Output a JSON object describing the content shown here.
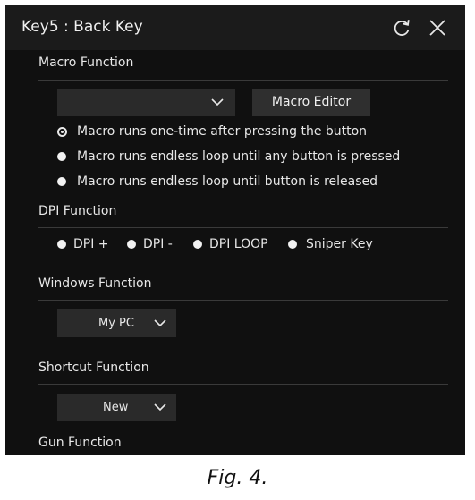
{
  "window": {
    "title": "Key5 : Back Key",
    "refresh_icon": "refresh-icon",
    "close_icon": "close-icon"
  },
  "macro": {
    "label": "Macro Function",
    "dropdown_value": "",
    "editor_button": "Macro Editor",
    "options": [
      {
        "label": "Macro runs one-time after pressing the button",
        "selected": true
      },
      {
        "label": "Macro runs endless loop until any button is pressed",
        "selected": false
      },
      {
        "label": "Macro runs endless loop until button is released",
        "selected": false
      }
    ]
  },
  "dpi": {
    "label": "DPI Function",
    "options": [
      "DPI +",
      "DPI -",
      "DPI LOOP",
      "Sniper Key"
    ]
  },
  "windows": {
    "label": "Windows Function",
    "dropdown_value": "My PC"
  },
  "shortcut": {
    "label": "Shortcut Function",
    "dropdown_value": "New"
  },
  "gun": {
    "label": "Gun Function"
  },
  "caption": "Fig. 4.",
  "colors": {
    "background": "#101010",
    "titlebar": "#1b1b1b",
    "control": "#2a2a2a",
    "text": "#e8e8e8"
  }
}
